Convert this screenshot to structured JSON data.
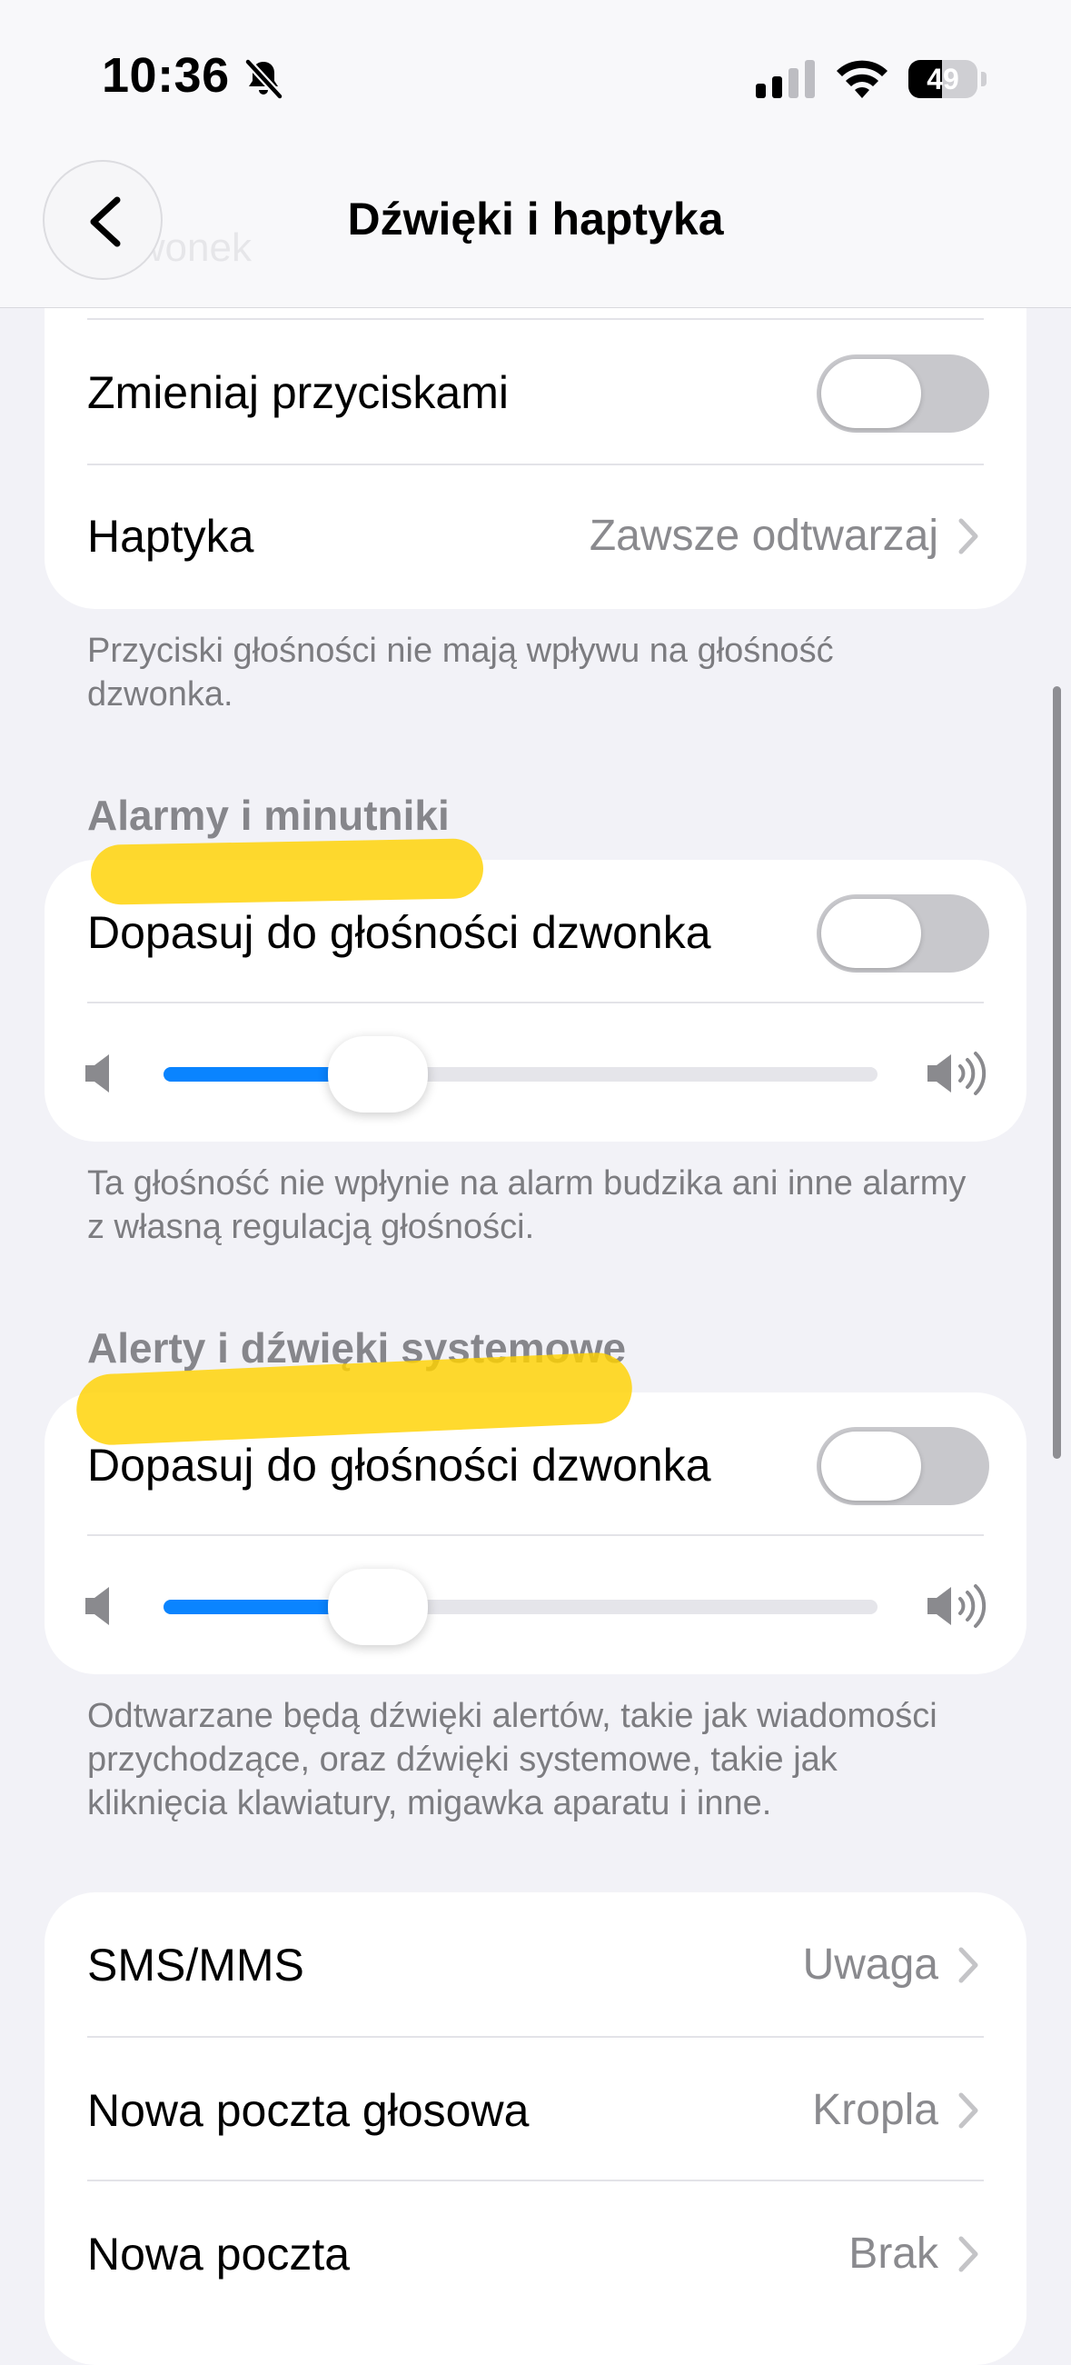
{
  "status_bar": {
    "time": "10:36",
    "battery_level": "49",
    "battery_fraction": 0.49
  },
  "nav": {
    "title": "Dźwięki i haptyka",
    "ghost_label": "Dzwonek"
  },
  "buttons_group": {
    "rows": [
      {
        "label": "Zmieniaj przyciskami",
        "toggle_on": false
      },
      {
        "label": "Haptyka",
        "value": "Zawsze odtwarzaj"
      }
    ],
    "footnote": "Przyciski głośności nie mają wpływu na głośność dzwonka."
  },
  "alarms_section": {
    "header": "Alarmy i minutniki",
    "toggle_label": "Dopasuj do głośności dzwonka",
    "toggle_on": false,
    "volume_fraction": 0.3,
    "footnote": "Ta głośność nie wpłynie na alarm budzika ani inne alarmy z własną regulacją głośności."
  },
  "alerts_section": {
    "header": "Alerty i dźwięki systemowe",
    "toggle_label": "Dopasuj do głośności dzwonka",
    "toggle_on": false,
    "volume_fraction": 0.3,
    "footnote": "Odtwarzane będą dźwięki alertów, takie jak wiadomości przychodzące, oraz dźwięki systemowe, takie jak kliknięcia klawiatury, migawka aparatu i inne."
  },
  "sounds_list": [
    {
      "label": "SMS/MMS",
      "value": "Uwaga"
    },
    {
      "label": "Nowa poczta głosowa",
      "value": "Kropla"
    },
    {
      "label": "Nowa poczta",
      "value": "Brak"
    }
  ],
  "colors": {
    "accent": "#0a84ff",
    "highlight": "#ffd200",
    "background": "#f2f2f7"
  }
}
